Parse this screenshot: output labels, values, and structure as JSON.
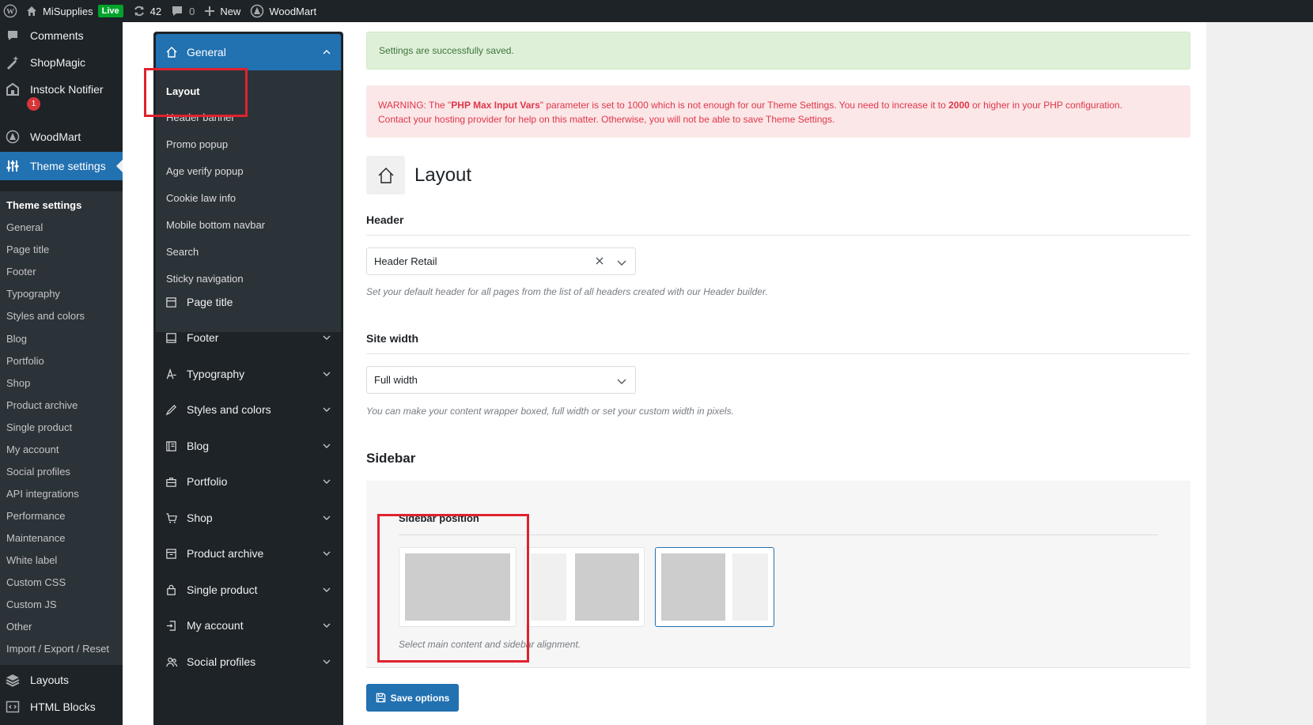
{
  "adminbar": {
    "site_name": "MiSupplies",
    "live_badge": "Live",
    "updates_count": "42",
    "comments_count": "0",
    "new_label": "New",
    "woodmart_label": "WoodMart"
  },
  "wp_menu": {
    "items": [
      {
        "label": "Comments",
        "icon": "comment-icon"
      },
      {
        "label": "ShopMagic",
        "icon": "wand-icon"
      },
      {
        "label": "Instock Notifier",
        "icon": "store-icon",
        "badge": "1"
      },
      {
        "label": "WoodMart",
        "icon": "woodmart-icon"
      },
      {
        "label": "Theme settings",
        "icon": "sliders-icon"
      },
      {
        "label": "Layouts",
        "icon": "layers-icon"
      },
      {
        "label": "HTML Blocks",
        "icon": "code-icon"
      }
    ],
    "submenu": [
      "Theme settings",
      "General",
      "Page title",
      "Footer",
      "Typography",
      "Styles and colors",
      "Blog",
      "Portfolio",
      "Shop",
      "Product archive",
      "Single product",
      "My account",
      "Social profiles",
      "API integrations",
      "Performance",
      "Maintenance",
      "White label",
      "Custom CSS",
      "Custom JS",
      "Other",
      "Import / Export / Reset"
    ]
  },
  "ts_nav": {
    "general": "General",
    "general_sub": [
      "Layout",
      "Header banner",
      "Promo popup",
      "Age verify popup",
      "Cookie law info",
      "Mobile bottom navbar",
      "Search",
      "Sticky navigation"
    ],
    "items": [
      "Page title",
      "Footer",
      "Typography",
      "Styles and colors",
      "Blog",
      "Portfolio",
      "Shop",
      "Product archive",
      "Single product",
      "My account",
      "Social profiles"
    ]
  },
  "notices": {
    "success": "Settings are successfully saved.",
    "warning_1": "WARNING: The \"",
    "warning_b1": "PHP Max Input Vars",
    "warning_2": "\" parameter is set to 1000 which is not enough for our Theme Settings. You need to increase it to ",
    "warning_b2": "2000",
    "warning_3": " or higher in your PHP configuration.",
    "warning_4": "Contact your hosting provider for help on this matter. Otherwise, you will not be able to save Theme Settings."
  },
  "main": {
    "title": "Layout",
    "header": {
      "label": "Header",
      "value": "Header Retail",
      "help": "Set your default header for all pages from the list of all headers created with our Header builder."
    },
    "site_width": {
      "label": "Site width",
      "value": "Full width",
      "help": "You can make your content wrapper boxed, full width or set your custom width in pixels."
    },
    "sidebar": {
      "title": "Sidebar",
      "position_label": "Sidebar position",
      "selected_option": 3,
      "help": "Select main content and sidebar alignment."
    },
    "save_label": "Save options"
  },
  "colors": {
    "admin_dark": "#1d2327",
    "accent": "#2271b1",
    "annotation_red": "#e0222e"
  }
}
